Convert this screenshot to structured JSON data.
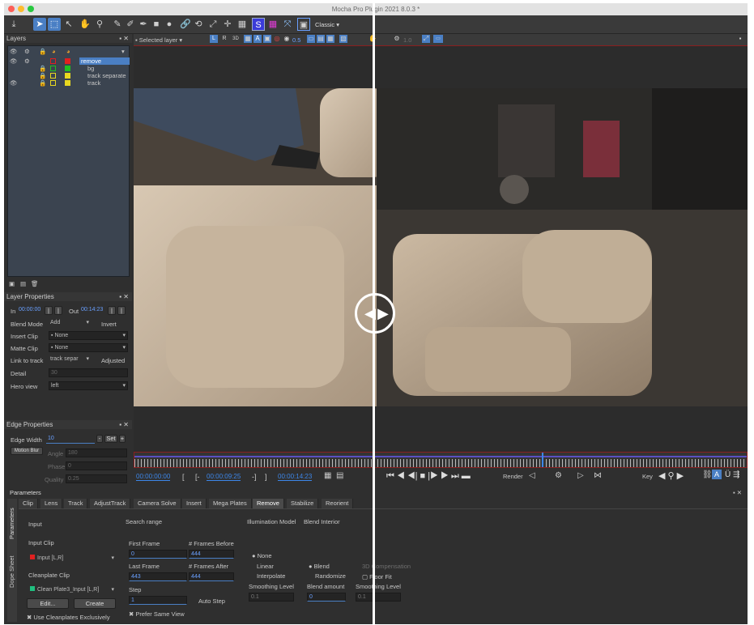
{
  "window": {
    "title": "Mocha Pro Plugin 2021 8.0.3 *"
  },
  "toolbar": {
    "workspace": "Classic"
  },
  "layers_panel": {
    "title": "Layers",
    "layers": [
      {
        "name": "remove"
      },
      {
        "name": "bg"
      },
      {
        "name": "track separate"
      },
      {
        "name": "track"
      }
    ]
  },
  "viewer_bar": {
    "selected_layer": "Selected layer",
    "opacity": "0.5",
    "zoom": "1.0"
  },
  "layer_properties": {
    "title": "Layer Properties",
    "in_label": "In",
    "in_value": "00:00:00",
    "out_label": "Out",
    "out_value": "00:14:23",
    "blend_mode_label": "Blend Mode",
    "blend_mode_value": "Add",
    "invert_label": "Invert",
    "insert_clip_label": "Insert Clip",
    "insert_clip_value": "None",
    "matte_clip_label": "Matte Clip",
    "matte_clip_value": "None",
    "link_label": "Link to track",
    "link_value": "track separ",
    "adjusted_label": "Adjusted",
    "detail_label": "Detail",
    "detail_value": "30",
    "hero_label": "Hero view",
    "hero_value": "left"
  },
  "edge_properties": {
    "title": "Edge Properties",
    "width_label": "Edge Width",
    "width_value": "10",
    "set_label": "Set",
    "motion_blur_label": "Motion Blur",
    "angle_label": "Angle",
    "angle_value": "180",
    "phase_label": "Phase",
    "phase_value": "0",
    "quality_label": "Quality",
    "quality_value": "0.25"
  },
  "timeline": {
    "current": "00:00:00:00",
    "in_point": "00:00:09:25",
    "out_point": "00:00:14:23",
    "render_label": "Render",
    "key_label": "Key"
  },
  "parameters": {
    "title": "Parameters",
    "side_tabs": [
      "Parameters",
      "Dope Sheet"
    ],
    "tabs": [
      "Clip",
      "Lens",
      "Track",
      "AdjustTrack",
      "Camera Solve",
      "Insert",
      "Mega Plates",
      "Remove",
      "Stabilize",
      "Reorient"
    ],
    "active_tab": "Remove",
    "input_label": "Input",
    "input_clip_label": "Input Clip",
    "input_clip_value": "Input [L,R]",
    "cleanplate_label": "Cleanplate Clip",
    "cleanplate_value": "Clean Plate3_Input [L,R]",
    "edit_label": "Edit...",
    "create_label": "Create",
    "use_cleanplates_label": "Use Cleanplates Exclusively",
    "search_range_label": "Search range",
    "first_frame_label": "First Frame",
    "first_frame_value": "0",
    "frames_before_label": "# Frames Before",
    "frames_before_value": "444",
    "last_frame_label": "Last Frame",
    "last_frame_value": "443",
    "frames_after_label": "# Frames After",
    "frames_after_value": "444",
    "step_label": "Step",
    "step_value": "1",
    "auto_step_label": "Auto Step",
    "prefer_same_view_label": "Prefer Same View",
    "illumination_label": "Illumination Model",
    "illum_none": "None",
    "illum_linear": "Linear",
    "illum_interpolate": "Interpolate",
    "smoothing_label": "Smoothing Level",
    "smoothing_value": "0.1",
    "blend_interior_label": "Blend Interior",
    "blend_label": "Blend",
    "randomize_label": "Randomize",
    "blend_amount_label": "Blend amount",
    "blend_amount_value": "0",
    "comp3d_label": "3D Compensation",
    "floor_label": "Floor Fit",
    "smoothing2_label": "Smoothing Level",
    "smoothing2_value": "0.1"
  },
  "colors": {
    "accent": "#4a7fc4",
    "selected_layer": "#4a7fc4",
    "timecode": "#3d86e8"
  }
}
